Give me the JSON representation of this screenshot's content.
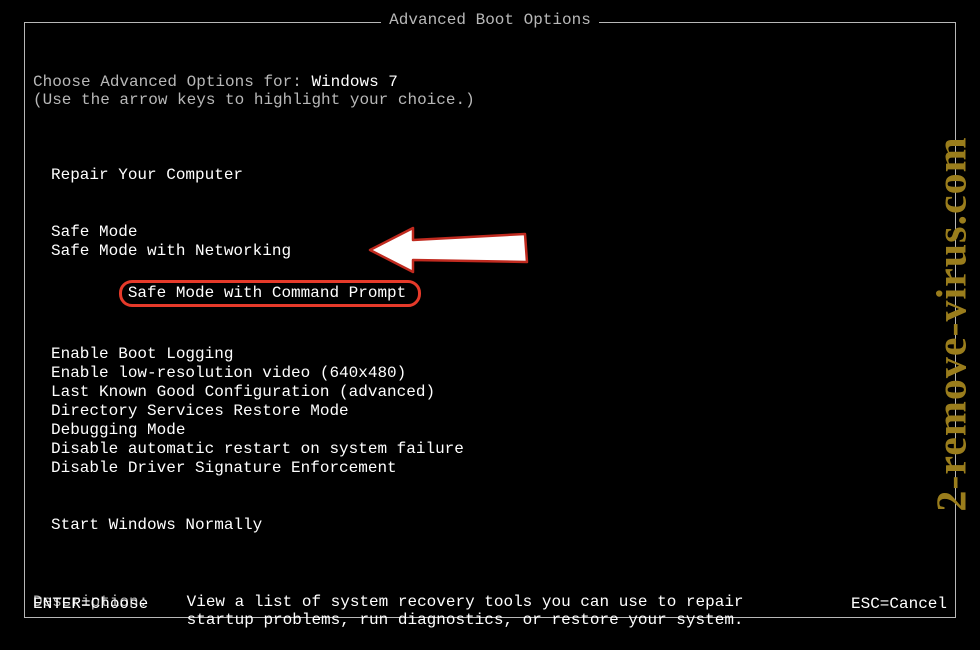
{
  "title": "Advanced Boot Options",
  "prompt": {
    "prefix": "Choose Advanced Options for: ",
    "os": "Windows 7",
    "hint": "(Use the arrow keys to highlight your choice.)"
  },
  "repair": "Repair Your Computer",
  "safemode": {
    "basic": "Safe Mode",
    "networking": "Safe Mode with Networking",
    "cmd": "Safe Mode with Command Prompt"
  },
  "opts": {
    "bootlog": "Enable Boot Logging",
    "lowres": "Enable low-resolution video (640x480)",
    "lkgc": "Last Known Good Configuration (advanced)",
    "dsrm": "Directory Services Restore Mode",
    "debug": "Debugging Mode",
    "noautorestart": "Disable automatic restart on system failure",
    "nodrvsig": "Disable Driver Signature Enforcement"
  },
  "normal": "Start Windows Normally",
  "description": {
    "label": "Description:    ",
    "text": "View a list of system recovery tools you can use to repair startup problems, run diagnostics, or restore your system."
  },
  "footer": {
    "enter": "ENTER=Choose",
    "esc": "ESC=Cancel"
  },
  "watermark": "2-remove-virus.com"
}
